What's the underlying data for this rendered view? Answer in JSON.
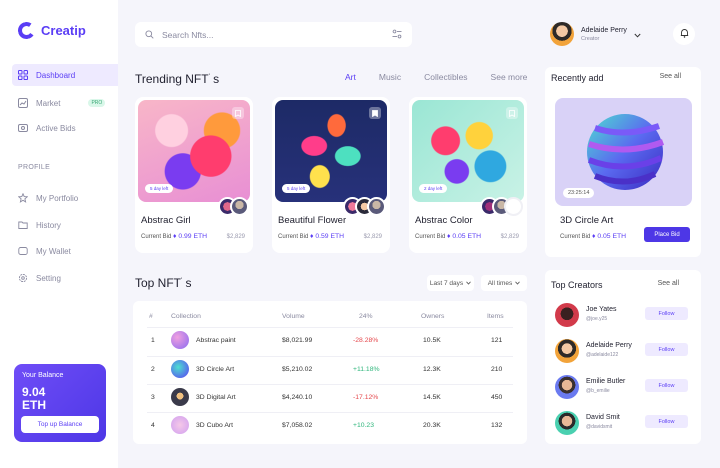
{
  "app": {
    "name": "Creatip"
  },
  "sidebar": {
    "items": [
      {
        "label": "Dashboard",
        "icon": "grid-icon",
        "active": true
      },
      {
        "label": "Market",
        "icon": "chart-icon",
        "badge": "PRO"
      },
      {
        "label": "Active Bids",
        "icon": "bids-icon"
      }
    ],
    "section": "PROFILE",
    "profile_items": [
      {
        "label": "My Portfolio",
        "icon": "star-icon"
      },
      {
        "label": "History",
        "icon": "folder-icon"
      },
      {
        "label": "My Wallet",
        "icon": "wallet-icon"
      },
      {
        "label": "Setting",
        "icon": "gear-icon"
      }
    ],
    "balance": {
      "label": "Your Balance",
      "value": "9.04",
      "unit": "ETH",
      "button": "Top up Balance"
    }
  },
  "header": {
    "search_placeholder": "Search Nfts...",
    "user": {
      "name": "Adelaide Perry",
      "role": "Creator"
    }
  },
  "trending": {
    "title": "Trending NFT",
    "title_suffix": "s",
    "tabs": [
      "Art",
      "Music",
      "Collectibles",
      "See more"
    ],
    "active_tab": "Art",
    "cards": [
      {
        "name": "Abstrac Girl",
        "time_left": "5 day left",
        "bid_label": "Current Bid",
        "bid": "0.99 ETH",
        "usd": "$2,829"
      },
      {
        "name": "Beautiful Flower",
        "time_left": "5 day left",
        "bid_label": "Current Bid",
        "bid": "0.59 ETH",
        "usd": "$2,829"
      },
      {
        "name": "Abstrac Color",
        "time_left": "2 day left",
        "bid_label": "Current Bid",
        "bid": "0.05 ETH",
        "usd": "$2,829"
      }
    ]
  },
  "recent": {
    "title": "Recently add",
    "see_all": "See all",
    "name": "3D Circle Art",
    "timer": "23:25:14",
    "bid_label": "Current Bid",
    "bid": "0.05 ETH",
    "button": "Place Bid"
  },
  "top_nfts": {
    "title": "Top NFT",
    "title_suffix": "s",
    "filters": [
      "Last 7 days",
      "All times"
    ],
    "columns": [
      "#",
      "Collection",
      "Volume",
      "24%",
      "Owners",
      "Items"
    ],
    "rows": [
      {
        "rank": "1",
        "collection": "Abstrac paint",
        "volume": "$8,021.99",
        "change": "-28.28%",
        "owners": "10.5K",
        "items": "121"
      },
      {
        "rank": "2",
        "collection": "3D Circle Art",
        "volume": "$5,210.02",
        "change": "+11.18%",
        "owners": "12.3K",
        "items": "210"
      },
      {
        "rank": "3",
        "collection": "3D Digital Art",
        "volume": "$4,240.10",
        "change": "-17.12%",
        "owners": "14.5K",
        "items": "450"
      },
      {
        "rank": "4",
        "collection": "3D Cubo Art",
        "volume": "$7,058.02",
        "change": "+10.23",
        "owners": "20.3K",
        "items": "132"
      }
    ]
  },
  "creators": {
    "title": "Top Creators",
    "see_all": "See all",
    "follow_label": "Follow",
    "list": [
      {
        "name": "Joe Yates",
        "handle": "@joe.y25"
      },
      {
        "name": "Adelaide Perry",
        "handle": "@adelaide122"
      },
      {
        "name": "Emilie Butler",
        "handle": "@b_emilie"
      },
      {
        "name": "David Smit",
        "handle": "@davidsmit"
      }
    ]
  },
  "colors": {
    "accent": "#5a3df5",
    "negative": "#e5484d",
    "positive": "#2fb67c"
  }
}
